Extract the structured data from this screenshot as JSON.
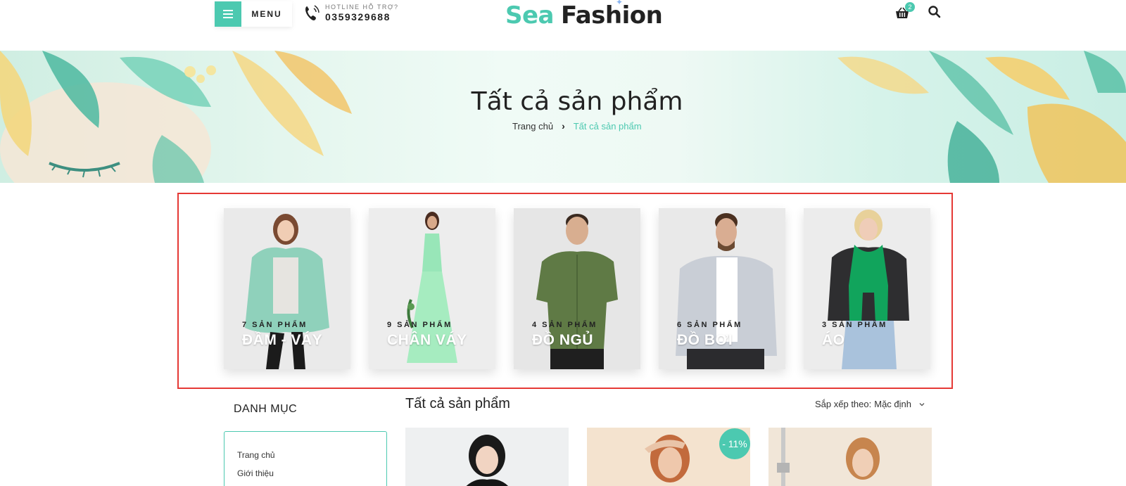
{
  "header": {
    "menu_label": "MENU",
    "hotline_label": "HOTLINE HỖ TRỢ?",
    "hotline_number": "0359329688",
    "logo_part1": "Sea",
    "logo_part2": "Fashion",
    "cart_count": "2"
  },
  "banner": {
    "title": "Tất cả sản phẩm",
    "breadcrumb_home": "Trang chủ",
    "breadcrumb_current": "Tất cả sản phẩm"
  },
  "categories": [
    {
      "count": "7 SẢN PHẨM",
      "name": "ĐẦM - VÁY"
    },
    {
      "count": "9 SẢN PHẨM",
      "name": "CHÂN VÁY"
    },
    {
      "count": "4 SẢN PHẨM",
      "name": "ĐỒ NGỦ"
    },
    {
      "count": "6 SẢN PHẨM",
      "name": "ĐỒ BƠI"
    },
    {
      "count": "3 SẢN PHẨM",
      "name": "ÁO"
    }
  ],
  "sidebar": {
    "title": "DANH MỤC",
    "links": [
      "Trang chủ",
      "Giới thiệu"
    ]
  },
  "products": {
    "title": "Tất cả sản phẩm",
    "sort_label": "Sắp xếp theo:",
    "sort_value": "Mặc định",
    "sale_badge": "- 11%"
  },
  "colors": {
    "accent": "#4cc9b0",
    "highlight_frame": "#e53935"
  }
}
